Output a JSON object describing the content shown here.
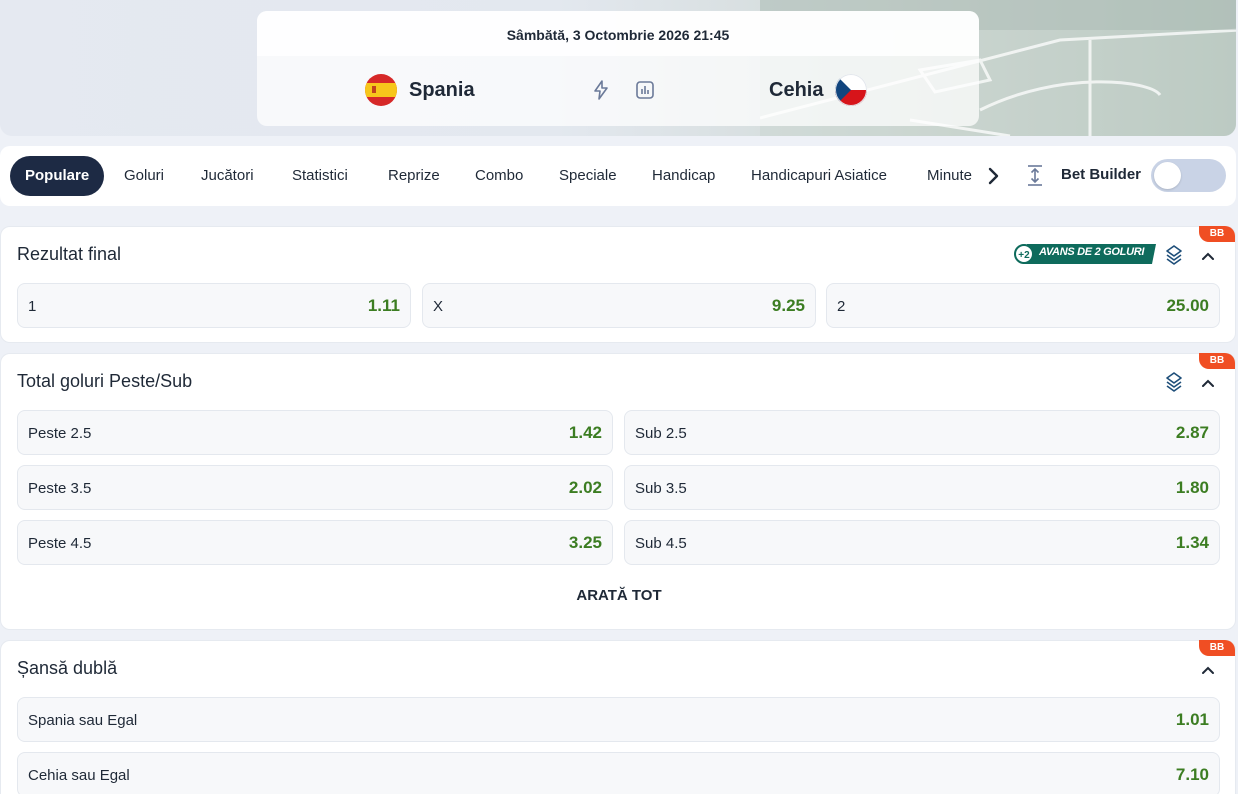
{
  "match": {
    "date": "Sâmbătă, 3 Octombrie 2026 21:45",
    "home": "Spania",
    "away": "Cehia"
  },
  "icons": {
    "live": "lightning-icon",
    "stats": "stats-chart-icon"
  },
  "tabs": [
    "Populare",
    "Goluri",
    "Jucători",
    "Statistici",
    "Reprize",
    "Combo",
    "Speciale",
    "Handicap",
    "Handicapuri Asiatice",
    "Minute"
  ],
  "bet_builder": {
    "label": "Bet Builder",
    "enabled": false
  },
  "badge": "BB",
  "colors": {
    "odd_value": "#3c7d22",
    "badge": "#f04e23",
    "active_tab": "#1d2a44",
    "avans": "#0e6b5c"
  },
  "sections": {
    "rezultat_final": {
      "title": "Rezultat final",
      "promo": "AVANS DE 2 GOLURI",
      "odds": [
        {
          "label": "1",
          "value": "1.11"
        },
        {
          "label": "X",
          "value": "9.25"
        },
        {
          "label": "2",
          "value": "25.00"
        }
      ]
    },
    "total_goluri": {
      "title": "Total goluri Peste/Sub",
      "odds": [
        {
          "label": "Peste 2.5",
          "value": "1.42"
        },
        {
          "label": "Sub 2.5",
          "value": "2.87"
        },
        {
          "label": "Peste 3.5",
          "value": "2.02"
        },
        {
          "label": "Sub 3.5",
          "value": "1.80"
        },
        {
          "label": "Peste 4.5",
          "value": "3.25"
        },
        {
          "label": "Sub 4.5",
          "value": "1.34"
        }
      ],
      "show_all": "ARATĂ TOT"
    },
    "sansa_dubla": {
      "title": "Șansă dublă",
      "odds": [
        {
          "label": "Spania sau Egal",
          "value": "1.01"
        },
        {
          "label": "Cehia sau Egal",
          "value": "7.10"
        }
      ]
    }
  }
}
